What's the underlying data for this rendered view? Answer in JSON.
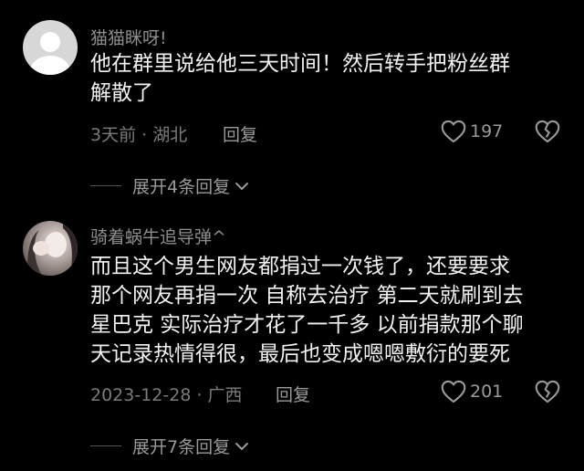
{
  "comments": [
    {
      "username": "猫猫眯呀!",
      "lines": [
        "他在群里说给他三天时间！然后转手把粉丝群",
        "解散了"
      ],
      "meta": "3天前 · 湖北",
      "reply_label": "回复",
      "likes": "197",
      "expand_label": "展开4条回复"
    },
    {
      "username": "骑着蜗牛追导弹^",
      "lines": [
        "而且这个男生网友都捐过一次钱了，还要要求",
        "那个网友再捐一次 自称去治疗 第二天就刷到去",
        "星巴克 实际治疗才花了一千多 以前捐款那个聊",
        "天记录热情得很，最后也变成嗯嗯敷衍的要死"
      ],
      "meta": "2023-12-28 · 广西",
      "reply_label": "回复",
      "likes": "201",
      "expand_label": "展开7条回复"
    }
  ],
  "colors": {
    "background": "#000000",
    "text": "#f2f2f2",
    "secondary": "#8e8e8e"
  },
  "icons": [
    "heart-outline-icon",
    "broken-heart-icon",
    "chevron-down-icon"
  ]
}
